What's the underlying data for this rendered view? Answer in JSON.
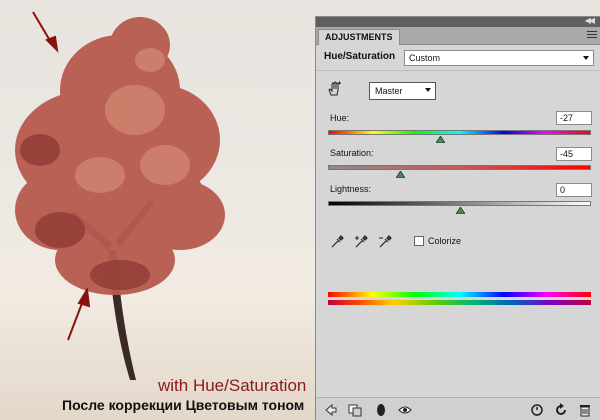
{
  "captions": {
    "english": "with Hue/Saturation",
    "russian": "После коррекции Цветовым тоном"
  },
  "panel": {
    "tab_label": "ADJUSTMENTS",
    "adjustment_title": "Hue/Saturation",
    "preset_value": "Custom",
    "channel_value": "Master",
    "hue": {
      "label": "Hue:",
      "value": "-27",
      "min": -180,
      "max": 180,
      "numeric": -27
    },
    "saturation": {
      "label": "Saturation:",
      "value": "-45",
      "min": -100,
      "max": 100,
      "numeric": -45
    },
    "lightness": {
      "label": "Lightness:",
      "value": "0",
      "min": -100,
      "max": 100,
      "numeric": 0
    },
    "colorize_label": "Colorize",
    "colorize_checked": false
  },
  "colors": {
    "panel_bg": "#d6d6d6",
    "caption_red": "#8b1a1a",
    "arrow_red": "#8b1010",
    "foliage": "#b85a4f"
  },
  "icons": [
    "collapse-icon",
    "panel-menu-icon",
    "hand-tool-icon",
    "eyedropper-icon",
    "eyedropper-plus-icon",
    "eyedropper-minus-icon",
    "back-arrow-icon",
    "clip-to-layer-icon",
    "visibility-mask-icon",
    "eye-icon",
    "previous-state-icon",
    "reset-icon",
    "trash-icon"
  ]
}
